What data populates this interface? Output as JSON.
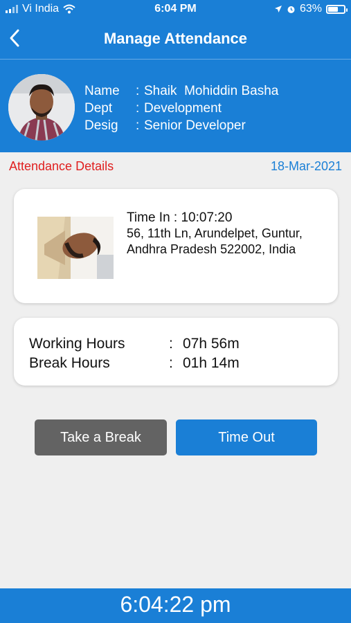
{
  "status_bar": {
    "carrier": "Vi India",
    "time": "6:04 PM",
    "battery_percent": "63%",
    "battery_level": 0.63
  },
  "nav": {
    "title": "Manage Attendance",
    "back_icon": "chevron-left-icon"
  },
  "profile": {
    "name_label": "Name",
    "name_value": "Shaik  Mohiddin Basha",
    "dept_label": "Dept",
    "dept_value": "Development",
    "desig_label": "Desig",
    "desig_value": "Senior Developer",
    "separator": ":"
  },
  "details": {
    "title": "Attendance Details",
    "date": "18-Mar-2021"
  },
  "time_in": {
    "label": "Time In : 10:07:20",
    "address_line1": "56, 11th Ln, Arundelpet, Guntur,",
    "address_line2": "Andhra Pradesh 522002, India"
  },
  "hours": {
    "working_label": "Working Hours",
    "working_value": "07h 56m",
    "break_label": "Break Hours",
    "break_value": "01h 14m",
    "separator": ":"
  },
  "actions": {
    "break_label": "Take a Break",
    "timeout_label": "Time Out"
  },
  "clock": {
    "time": "6:04:22 pm"
  },
  "colors": {
    "primary": "#1a7fd6",
    "accent_red": "#e01e1e",
    "button_gray": "#636363"
  }
}
